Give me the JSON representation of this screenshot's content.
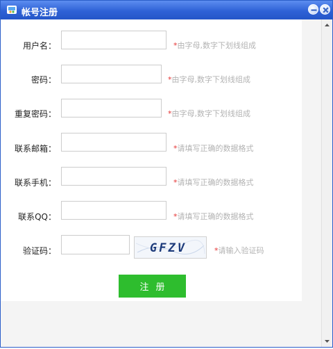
{
  "window": {
    "title": "帐号注册"
  },
  "icons": {
    "app": "app-logo-icon",
    "minimize": "minimize-icon",
    "close": "close-icon",
    "scroll_up": "scroll-up-arrow-icon",
    "scroll_down": "scroll-down-arrow-icon"
  },
  "colors": {
    "titlebar": "#2f62d6",
    "required_star": "#e53333",
    "hint": "#b3b3b3",
    "register_button": "#2ebd2e"
  },
  "form": {
    "username": {
      "label": "用户名：",
      "value": "",
      "hint_star": "*",
      "hint": "由字母,数字下划线组成"
    },
    "password": {
      "label": "密码：",
      "value": "",
      "hint_star": "*",
      "hint": "由字母,数字下划线组成"
    },
    "confirm_password": {
      "label": "重复密码：",
      "value": "",
      "hint_star": "*",
      "hint": "由字母,数字下划线组成"
    },
    "email": {
      "label": "联系邮箱：",
      "value": "",
      "hint_star": "*",
      "hint": "请填写正确的数据格式"
    },
    "phone": {
      "label": "联系手机：",
      "value": "",
      "hint_star": "*",
      "hint": "请填写正确的数据格式"
    },
    "qq": {
      "label": "联系QQ：",
      "value": "",
      "hint_star": "*",
      "hint": "请填写正确的数据格式"
    },
    "captcha": {
      "label": "验证码：",
      "value": "",
      "image_text": "GFZV",
      "hint_star": "*",
      "hint": "请输入验证码"
    },
    "submit_label": "注册"
  }
}
